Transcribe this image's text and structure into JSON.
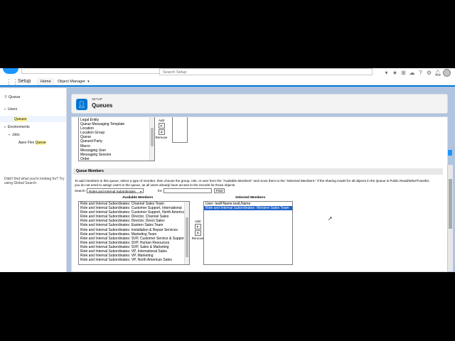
{
  "header": {
    "search_placeholder": "Search Setup",
    "icons": [
      "dropdown-icon",
      "favorites-icon",
      "add-icon",
      "trailhead-icon",
      "help-icon",
      "gear-icon",
      "notifications-icon",
      "avatar"
    ]
  },
  "nav": {
    "app_name": "Setup",
    "tabs": [
      {
        "label": "Home",
        "active": true
      },
      {
        "label": "Object Manager",
        "active": false
      }
    ]
  },
  "sidebar": {
    "quick_find_value": "Queue",
    "users_label": "Users",
    "queues_label": "Queues",
    "environments_label": "Environments",
    "jobs_label": "Jobs",
    "apex_flex_prefix": "Apex Flex ",
    "apex_flex_hl": "Queue",
    "help_text": "Didn't find what you're looking for? Try using Global Search."
  },
  "page": {
    "breadcrumb": "SETUP",
    "title": "Queues"
  },
  "objects_list": {
    "items": [
      "Legal Entity",
      "Queue Messaging Template",
      "Location",
      "Location Group",
      "Queue",
      "Queued Party",
      "Macro",
      "Messaging User",
      "Messaging Session",
      "Order"
    ],
    "add_label": "Add",
    "remove_label": "Remove"
  },
  "queue_members": {
    "section_title": "Queue Members",
    "instructions": "To add members to this queue, select a type of member, then choose the group, role, or user from the \"Available Members\" and move them to the \"Selected Members.\" If the sharing model for all objects in the Queue is Public Read/Write/Transfer, you do not need to assign users to the queue, as all users already have access to the records for those objects.",
    "search_label": "Search:",
    "search_type": "Roles and Internal Subordinates",
    "for_label": "for:",
    "find_label": "Find",
    "available_header": "Available Members",
    "selected_header": "Selected Members",
    "add_label": "Add",
    "remove_label": "Remove",
    "available": [
      "Role and Internal Subordinates: Channel Sales Team",
      "Role and Internal Subordinates: Customer Support, International",
      "Role and Internal Subordinates: Customer Support, North America",
      "Role and Internal Subordinates: Director, Channel Sales",
      "Role and Internal Subordinates: Director, Direct Sales",
      "Role and Internal Subordinates: Eastern Sales Team",
      "Role and Internal Subordinates: Installation & Repair Services",
      "Role and Internal Subordinates: Marketing Team",
      "Role and Internal Subordinates: SVP, Customer Service & Support",
      "Role and Internal Subordinates: SVP, Human Resources",
      "Role and Internal Subordinates: SVP, Sales & Marketing",
      "Role and Internal Subordinates: VP, International Sales",
      "Role and Internal Subordinates: VP, Marketing",
      "Role and Internal Subordinates: VP, North American Sales"
    ],
    "selected": [
      {
        "label": "User: testFName testLName",
        "selected": false
      },
      {
        "label": "Role and Internal Subordinates: Western Sales Team",
        "selected": true
      }
    ]
  },
  "colors": {
    "brand_blue": "#0176d3",
    "selection_blue": "#1e62c8",
    "highlight_yellow": "#fff59a"
  }
}
